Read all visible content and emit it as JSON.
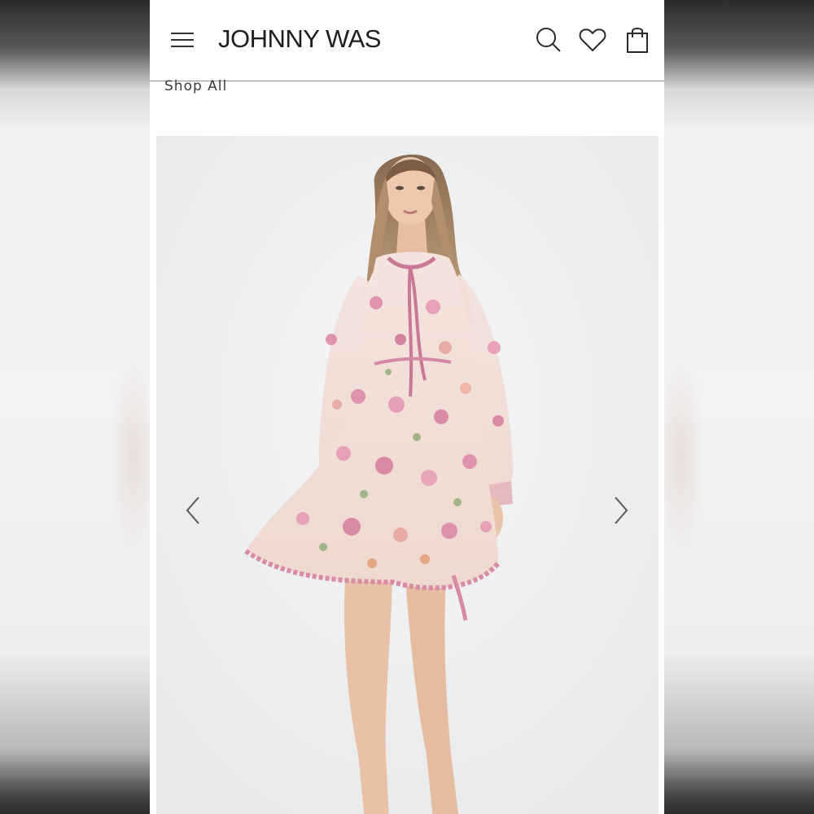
{
  "header": {
    "brand": "JOHNNY WAS",
    "icons": [
      "menu-icon",
      "search-icon",
      "heart-icon",
      "shopping-bag-icon"
    ]
  },
  "breadcrumb": {
    "label": "Shop All"
  },
  "gallery": {
    "prev_icon": "chevron-left-icon",
    "next_icon": "chevron-right-icon",
    "product_image": "model wearing long-sleeve floral print mini dress"
  },
  "colors": {
    "background": "#ffffff",
    "text": "#1e1e1e",
    "divider": "#8e8e8e",
    "dress_pink": "#d98aa5",
    "dress_cream": "#f3e4d8"
  }
}
